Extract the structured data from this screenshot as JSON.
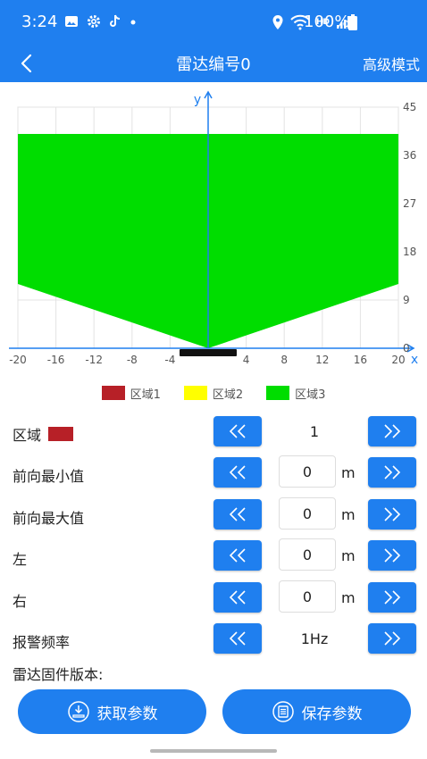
{
  "status_bar": {
    "time": "3:24",
    "battery": "100%",
    "hd": "HD"
  },
  "app_bar": {
    "title": "雷达编号0",
    "advanced_mode": "高级模式"
  },
  "chart_data": {
    "type": "area",
    "x_ticks": [
      "-20",
      "-16",
      "-12",
      "-8",
      "-4",
      "0",
      "4",
      "8",
      "12",
      "16",
      "20"
    ],
    "y_ticks": [
      "0",
      "9",
      "18",
      "27",
      "36",
      "45"
    ],
    "xlabel": "x",
    "ylabel": "y",
    "xlim": [
      -20,
      20
    ],
    "ylim": [
      0,
      45
    ],
    "grid": true,
    "series": [
      {
        "name": "区域3",
        "color": "#00dd00",
        "x": [
          -20,
          -20,
          0,
          20,
          20
        ],
        "y": [
          40,
          12,
          0,
          12,
          40
        ]
      }
    ]
  },
  "legend": [
    {
      "label": "区域1",
      "color": "#b72027"
    },
    {
      "label": "区域2",
      "color": "#ffff00"
    },
    {
      "label": "区域3",
      "color": "#00dd00"
    }
  ],
  "form": {
    "area": {
      "label": "区域",
      "value": "1"
    },
    "forward_min": {
      "label": "前向最小值",
      "value": "0",
      "unit": "m"
    },
    "forward_max": {
      "label": "前向最大值",
      "value": "0",
      "unit": "m"
    },
    "left": {
      "label": "左",
      "value": "0",
      "unit": "m"
    },
    "right": {
      "label": "右",
      "value": "0",
      "unit": "m"
    },
    "alarm_freq": {
      "label": "报警频率",
      "value": "1Hz"
    },
    "firmware_label": "雷达固件版本:"
  },
  "buttons": {
    "get_params": "获取参数",
    "save_params": "保存参数"
  }
}
